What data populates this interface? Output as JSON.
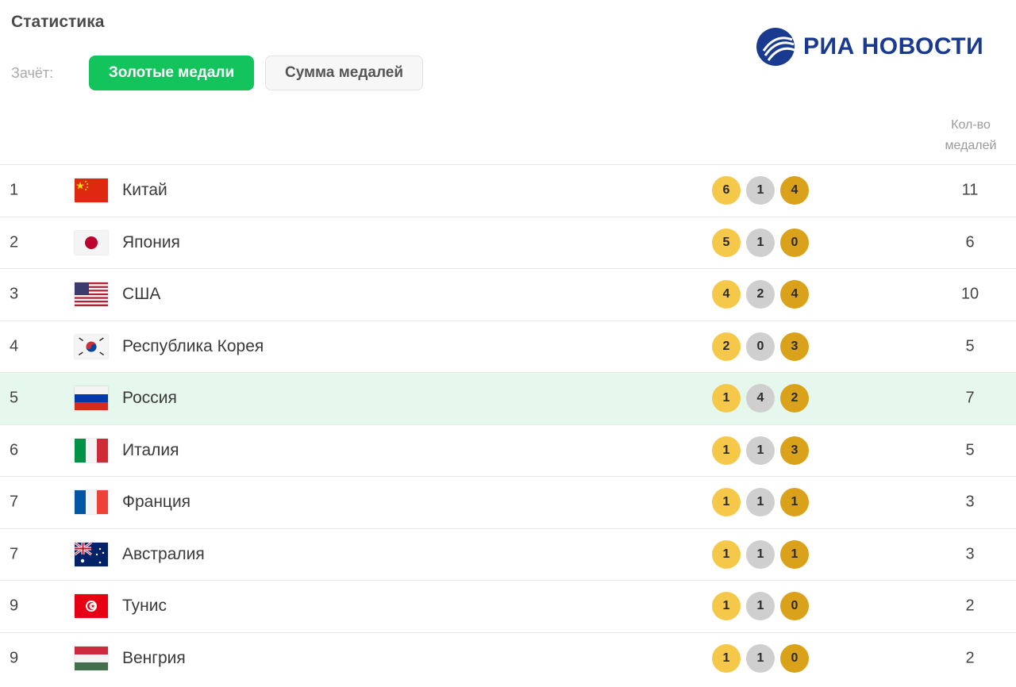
{
  "header": {
    "title": "Статистика",
    "filter_label": "Зачёт:",
    "btn_gold": "Золотые медали",
    "btn_sum": "Сумма медалей",
    "logo_text": "РИА НОВОСТИ",
    "col_total_line1": "Кол-во",
    "col_total_line2": "медалей"
  },
  "colors": {
    "accent": "#13c35c",
    "highlight_row": "#e6f7ed",
    "gold": "#f6c84a",
    "silver": "#cfcfcf",
    "bronze": "#d9a21a",
    "logo": "#1a3a8f"
  },
  "rows": [
    {
      "rank": "1",
      "country": "Китай",
      "flag": "china-flag-icon",
      "gold": "6",
      "silver": "1",
      "bronze": "4",
      "total": "11"
    },
    {
      "rank": "2",
      "country": "Япония",
      "flag": "japan-flag-icon",
      "gold": "5",
      "silver": "1",
      "bronze": "0",
      "total": "6"
    },
    {
      "rank": "3",
      "country": "США",
      "flag": "usa-flag-icon",
      "gold": "4",
      "silver": "2",
      "bronze": "4",
      "total": "10"
    },
    {
      "rank": "4",
      "country": "Республика Корея",
      "flag": "korea-flag-icon",
      "gold": "2",
      "silver": "0",
      "bronze": "3",
      "total": "5"
    },
    {
      "rank": "5",
      "country": "Россия",
      "flag": "russia-flag-icon",
      "gold": "1",
      "silver": "4",
      "bronze": "2",
      "total": "7",
      "highlight": true
    },
    {
      "rank": "6",
      "country": "Италия",
      "flag": "italy-flag-icon",
      "gold": "1",
      "silver": "1",
      "bronze": "3",
      "total": "5"
    },
    {
      "rank": "7",
      "country": "Франция",
      "flag": "france-flag-icon",
      "gold": "1",
      "silver": "1",
      "bronze": "1",
      "total": "3"
    },
    {
      "rank": "7",
      "country": "Австралия",
      "flag": "australia-flag-icon",
      "gold": "1",
      "silver": "1",
      "bronze": "1",
      "total": "3"
    },
    {
      "rank": "9",
      "country": "Тунис",
      "flag": "tunisia-flag-icon",
      "gold": "1",
      "silver": "1",
      "bronze": "0",
      "total": "2"
    },
    {
      "rank": "9",
      "country": "Венгрия",
      "flag": "hungary-flag-icon",
      "gold": "1",
      "silver": "1",
      "bronze": "0",
      "total": "2"
    }
  ]
}
